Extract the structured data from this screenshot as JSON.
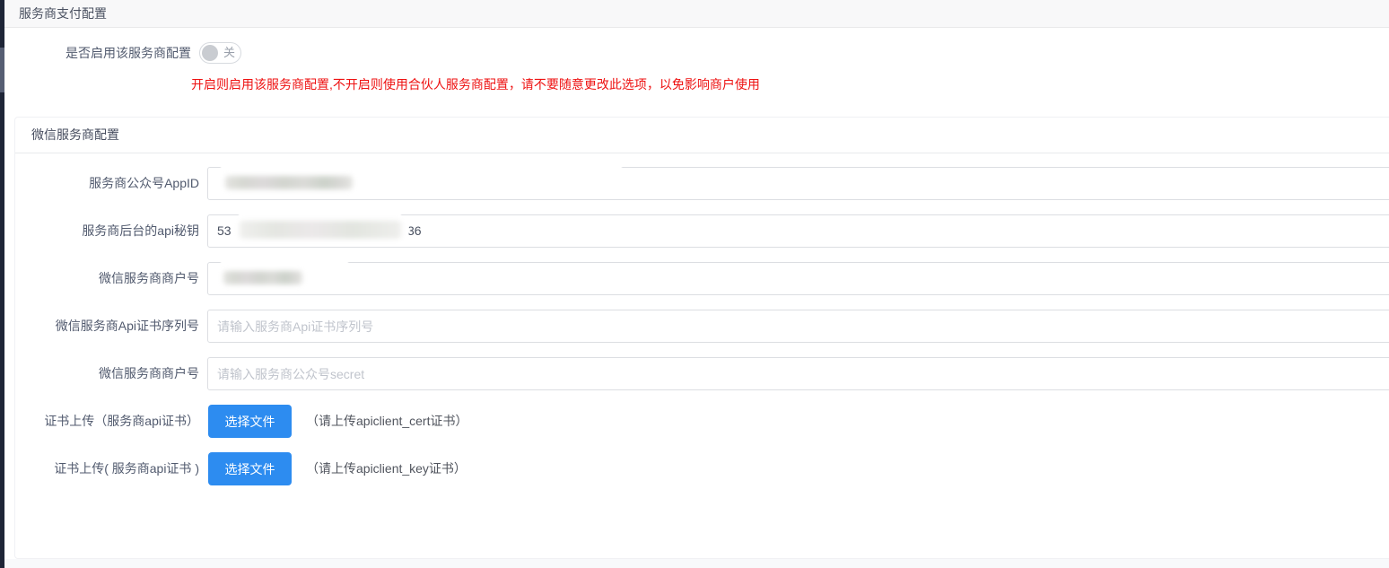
{
  "window": {
    "title": "服务商支付配置"
  },
  "enable_row": {
    "label": "是否启用该服务商配置",
    "switch": {
      "state": "off",
      "state_text": "关"
    }
  },
  "warning_text": "开启则启用该服务商配置,不开启则使用合伙人服务商配置，请不要随意更改此选项，以免影响商户使用",
  "section": {
    "title": "微信服务商配置"
  },
  "form": {
    "fields": [
      {
        "label": "服务商公众号AppID",
        "value_masked": true
      },
      {
        "label": "服务商后台的api秘钥",
        "value_masked": true,
        "value_prefix": "53",
        "value_suffix": "36"
      },
      {
        "label": "微信服务商商户号",
        "value_masked": true
      },
      {
        "label": "微信服务商Api证书序列号",
        "placeholder": "请输入服务商Api证书序列号",
        "value": ""
      },
      {
        "label": "微信服务商商户号",
        "placeholder": "请输入服务商公众号secret",
        "value": ""
      }
    ],
    "uploads": [
      {
        "label": "证书上传（服务商api证书）",
        "button": "选择文件",
        "note": "（请上传apiclient_cert证书）"
      },
      {
        "label": "证书上传( 服务商api证书 )",
        "button": "选择文件",
        "note": "（请上传apiclient_key证书）"
      }
    ]
  },
  "colors": {
    "primary_button": "#2d8cf0",
    "warning_text": "#ee1111",
    "sidebar_strip": "#1e2537",
    "input_border": "#dcdee2",
    "topbar_bg": "#f8f8f9"
  }
}
